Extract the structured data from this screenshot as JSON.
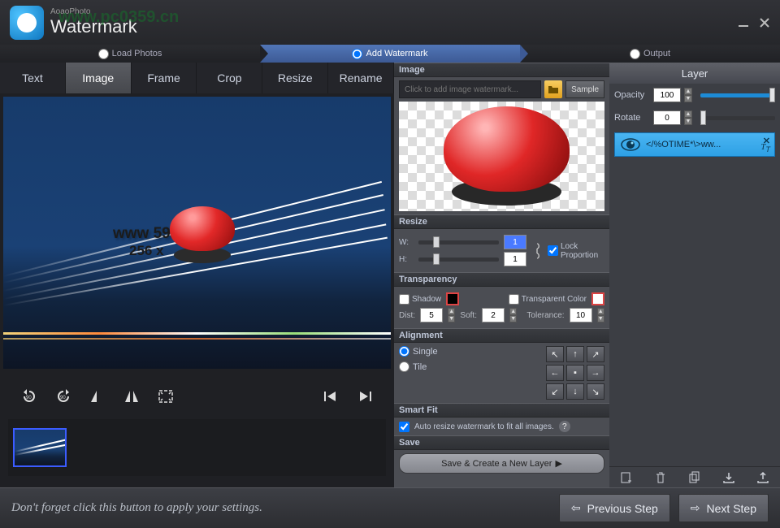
{
  "titlebar": {
    "brand_small": "AoaoPhoto",
    "brand_big": "Watermark",
    "faint_overlay": "www.pc0359.cn"
  },
  "steps": {
    "load": "Load Photos",
    "add": "Add Watermark",
    "output": "Output"
  },
  "tabs": [
    "Text",
    "Image",
    "Frame",
    "Crop",
    "Resize",
    "Rename"
  ],
  "active_tab_index": 1,
  "preview": {
    "watermark_text": "www        59.cn",
    "size_text": "256 x"
  },
  "tools": {
    "rotate_left_label": "90",
    "rotate_right_label": "90"
  },
  "image_panel": {
    "header": "Image",
    "input_placeholder": "Click to add image watermark...",
    "sample": "Sample"
  },
  "resize_panel": {
    "header": "Resize",
    "w_label": "W:",
    "h_label": "H:",
    "w_value": "1",
    "h_value": "1",
    "lock": "Lock Proportion"
  },
  "transparency_panel": {
    "header": "Transparency",
    "shadow": "Shadow",
    "transparent_color": "Transparent Color",
    "dist_label": "Dist:",
    "dist_value": "5",
    "soft_label": "Soft:",
    "soft_value": "2",
    "tolerance_label": "Tolerance:",
    "tolerance_value": "10"
  },
  "alignment_panel": {
    "header": "Alignment",
    "single": "Single",
    "tile": "Tile"
  },
  "smartfit_panel": {
    "header": "Smart Fit",
    "auto_text": "Auto resize watermark to fit all images."
  },
  "save_panel": {
    "header": "Save",
    "button": "Save & Create a New Layer"
  },
  "layer_panel": {
    "header": "Layer",
    "opacity_label": "Opacity",
    "opacity_value": "100",
    "rotate_label": "Rotate",
    "rotate_value": "0",
    "item_text": "</%OTIME*\\>ww..."
  },
  "footer": {
    "hint": "Don't forget click this button to apply your settings.",
    "prev": "Previous Step",
    "next": "Next Step"
  }
}
